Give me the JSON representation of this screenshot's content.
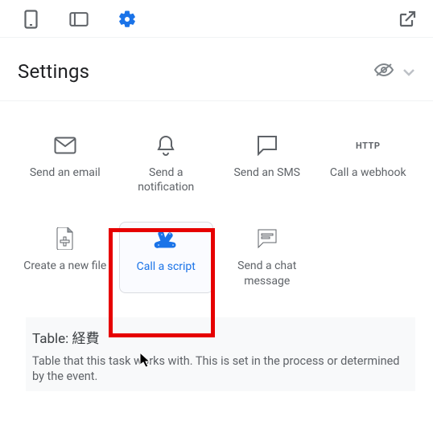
{
  "header": {
    "title": "Settings"
  },
  "tiles": [
    {
      "label": "Send an email"
    },
    {
      "label": "Send a notification"
    },
    {
      "label": "Send an SMS"
    },
    {
      "label": "Call a webhook",
      "httpBadge": "HTTP"
    },
    {
      "label": "Create a new file"
    },
    {
      "label": "Call a script"
    },
    {
      "label": "Send a chat message"
    }
  ],
  "info": {
    "title_prefix": "Table: ",
    "table_name": "経費",
    "description": "Table that this task works with. This is set in the process or determined by the event."
  }
}
